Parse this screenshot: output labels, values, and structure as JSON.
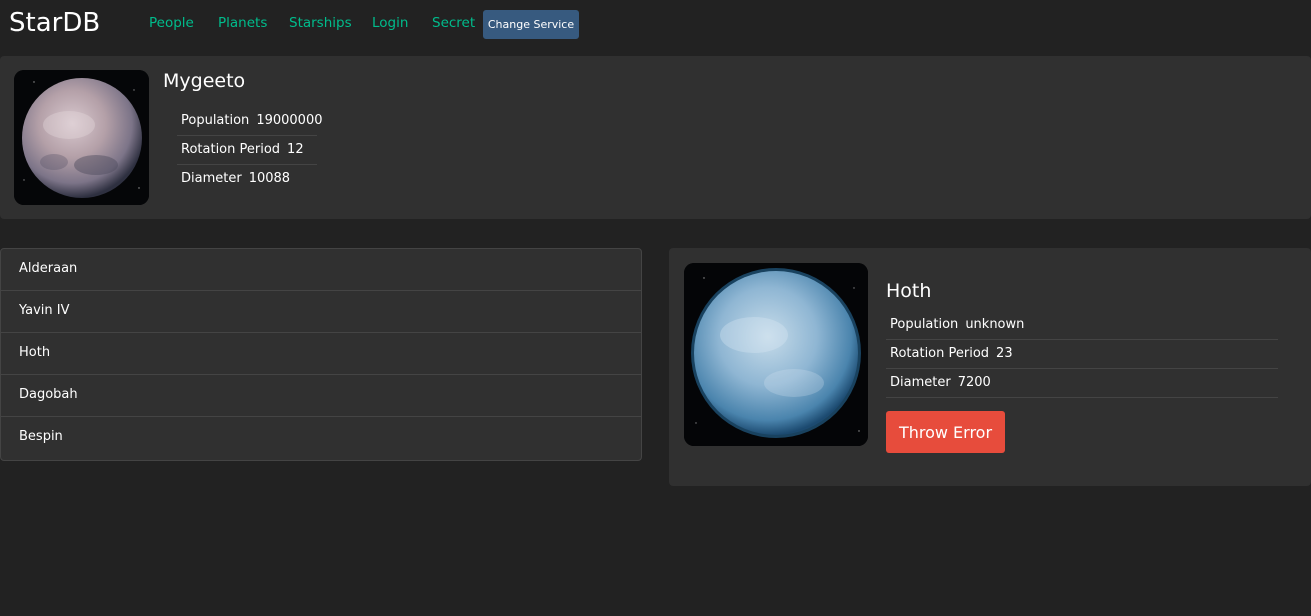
{
  "header": {
    "brand": "StarDB",
    "nav": [
      "People",
      "Planets",
      "Starships",
      "Login",
      "Secret"
    ],
    "change_service": "Change Service"
  },
  "random_planet": {
    "name": "Mygeeto",
    "details": [
      {
        "term": "Population",
        "value": "19000000"
      },
      {
        "term": "Rotation Period",
        "value": "12"
      },
      {
        "term": "Diameter",
        "value": "10088"
      }
    ]
  },
  "planet_list": [
    "Alderaan",
    "Yavin IV",
    "Hoth",
    "Dagobah",
    "Bespin"
  ],
  "planet_details": {
    "name": "Hoth",
    "details": [
      {
        "term": "Population",
        "value": "unknown"
      },
      {
        "term": "Rotation Period",
        "value": "23"
      },
      {
        "term": "Diameter",
        "value": "7200"
      }
    ],
    "throw_error": "Throw Error"
  },
  "colors": {
    "background": "#222222",
    "card": "#303030",
    "link": "#00bc8c",
    "primary": "#375a7f",
    "danger": "#e74c3c"
  }
}
